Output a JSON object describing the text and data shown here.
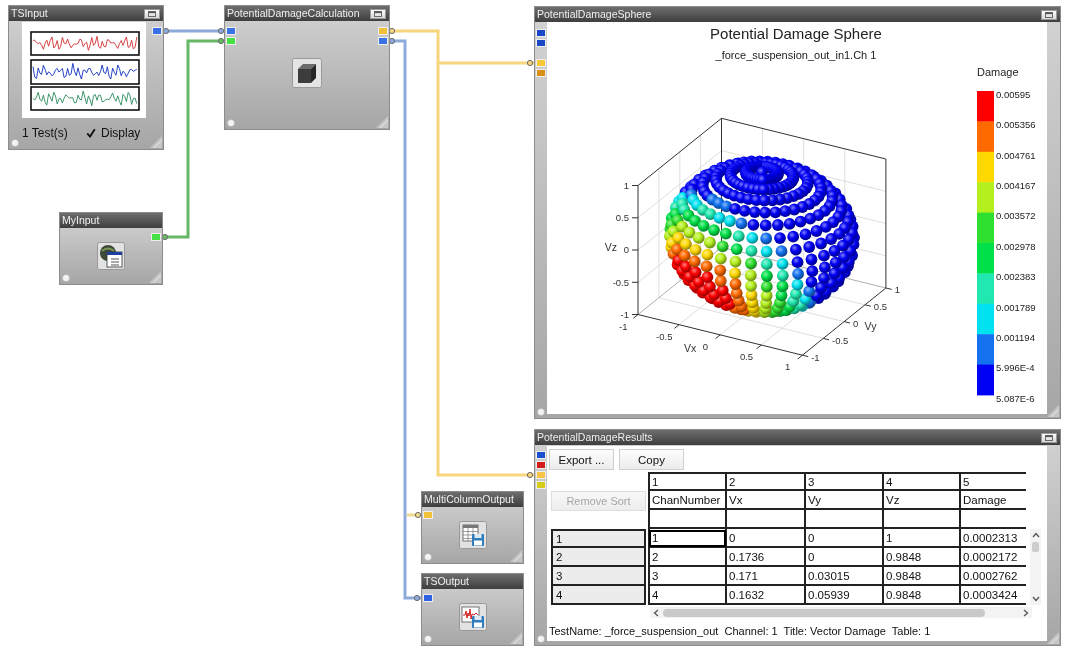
{
  "nodes": [
    {
      "kind": "plotsource",
      "title": "TSInput",
      "window_button": true,
      "outputs": [
        {
          "color": "#3a6ee8"
        }
      ],
      "tests": "1 Test(s)",
      "display": {
        "label": "Display",
        "checked": true
      }
    },
    {
      "kind": "compute",
      "title": "PotentialDamageCalculation",
      "window_button": true,
      "inputs": [
        {
          "color": "#3a72e8"
        },
        {
          "color": "#44e044"
        }
      ],
      "outputs": [
        {
          "color": "#f0c23a"
        },
        {
          "color": "#3a72e8"
        }
      ]
    },
    {
      "kind": "chart",
      "title": "PotentialDamageSphere",
      "window_button": true,
      "inputs": [
        {
          "color": "#1848c8"
        },
        {
          "color": "#1848c8"
        },
        {
          "color": "#f5c83a"
        },
        {
          "color": "#d8901a"
        }
      ],
      "plot": {
        "title": "Potential Damage Sphere",
        "subtitle": "_force_suspension_out_in1.Ch 1",
        "z_axis": {
          "title": "Vz",
          "ticks": [
            "1",
            "0.5",
            "0",
            "-0.5",
            "-1"
          ]
        },
        "x_axis": {
          "title": "Vx",
          "ticks": [
            "-1",
            "-0.5",
            "0",
            "0.5",
            "1"
          ]
        },
        "y_axis": {
          "title": "Vy",
          "ticks": [
            "1",
            "0.5",
            "0",
            "-0.5",
            "-1"
          ]
        },
        "colorbar": {
          "title": "Damage",
          "labels": [
            "0.00595",
            "0.005356",
            "0.004761",
            "0.004167",
            "0.003572",
            "0.002978",
            "0.002383",
            "0.001789",
            "0.001194",
            "5.996E-4",
            "5.087E-6"
          ],
          "bands": [
            {
              "color": "#ff0000"
            },
            {
              "color": "#ff6a00"
            },
            {
              "color": "#ffd800"
            },
            {
              "color": "#b4f01e"
            },
            {
              "color": "#30e030"
            },
            {
              "color": "#00e048"
            },
            {
              "color": "#20e8b0"
            },
            {
              "color": "#00e2f0"
            },
            {
              "color": "#1472f0"
            },
            {
              "color": "#0000f5"
            }
          ]
        }
      }
    },
    {
      "kind": "form",
      "title": "MyInput",
      "window_button": false,
      "outputs": [
        {
          "color": "#44e044"
        }
      ]
    },
    {
      "kind": "grid",
      "title": "PotentialDamageResults",
      "window_button": true,
      "inputs": [
        {
          "color": "#1a4fd0"
        },
        {
          "color": "#d41c1c"
        },
        {
          "color": "#f6c445"
        },
        {
          "color": "#d6cc1c"
        }
      ],
      "buttons": [
        {
          "label": "Export ...",
          "disabled": false
        },
        {
          "label": "Copy",
          "disabled": false
        }
      ],
      "sort_button": {
        "label": "Remove Sort",
        "disabled": true
      },
      "columns": [
        {
          "number": "1",
          "name": "ChanNumber"
        },
        {
          "number": "2",
          "name": "Vx"
        },
        {
          "number": "3",
          "name": "Vy"
        },
        {
          "number": "4",
          "name": "Vz"
        },
        {
          "number": "5",
          "name": "Damage"
        }
      ],
      "rows": [
        {
          "label": "1",
          "cells": [
            {
              "text": "1",
              "selected": true
            },
            {
              "text": "0",
              "selected": false
            },
            {
              "text": "0",
              "selected": false
            },
            {
              "text": "1",
              "selected": false
            },
            {
              "text": "0.0002313",
              "selected": false
            }
          ]
        },
        {
          "label": "2",
          "cells": [
            {
              "text": "2",
              "selected": false
            },
            {
              "text": "0.1736",
              "selected": false
            },
            {
              "text": "0",
              "selected": false
            },
            {
              "text": "0.9848",
              "selected": false
            },
            {
              "text": "0.0002172",
              "selected": false
            }
          ]
        },
        {
          "label": "3",
          "cells": [
            {
              "text": "3",
              "selected": false
            },
            {
              "text": "0.171",
              "selected": false
            },
            {
              "text": "0.03015",
              "selected": false
            },
            {
              "text": "0.9848",
              "selected": false
            },
            {
              "text": "0.0002762",
              "selected": false
            }
          ]
        },
        {
          "label": "4",
          "cells": [
            {
              "text": "4",
              "selected": false
            },
            {
              "text": "0.1632",
              "selected": false
            },
            {
              "text": "0.05939",
              "selected": false
            },
            {
              "text": "0.9848",
              "selected": false
            },
            {
              "text": "0.0003424",
              "selected": false
            }
          ]
        }
      ],
      "info": "TestName: _force_suspension_out  Channel: 1  Title: Vector Damage  Table: 1"
    },
    {
      "kind": "tableexport",
      "title": "MultiColumnOutput",
      "window_button": false,
      "inputs": [
        {
          "color": "#f0c23a"
        }
      ]
    },
    {
      "kind": "waveexport",
      "title": "TSOutput",
      "window_button": false,
      "inputs": [
        {
          "color": "#2f62e0"
        }
      ]
    }
  ],
  "links": [
    {
      "color": "#8eaadb"
    },
    {
      "color": "#66b866"
    },
    {
      "color": "#f8d57c"
    },
    {
      "color": "#f8d57c"
    },
    {
      "color": "#8eaadb"
    },
    {
      "color": "#eed98c"
    }
  ]
}
